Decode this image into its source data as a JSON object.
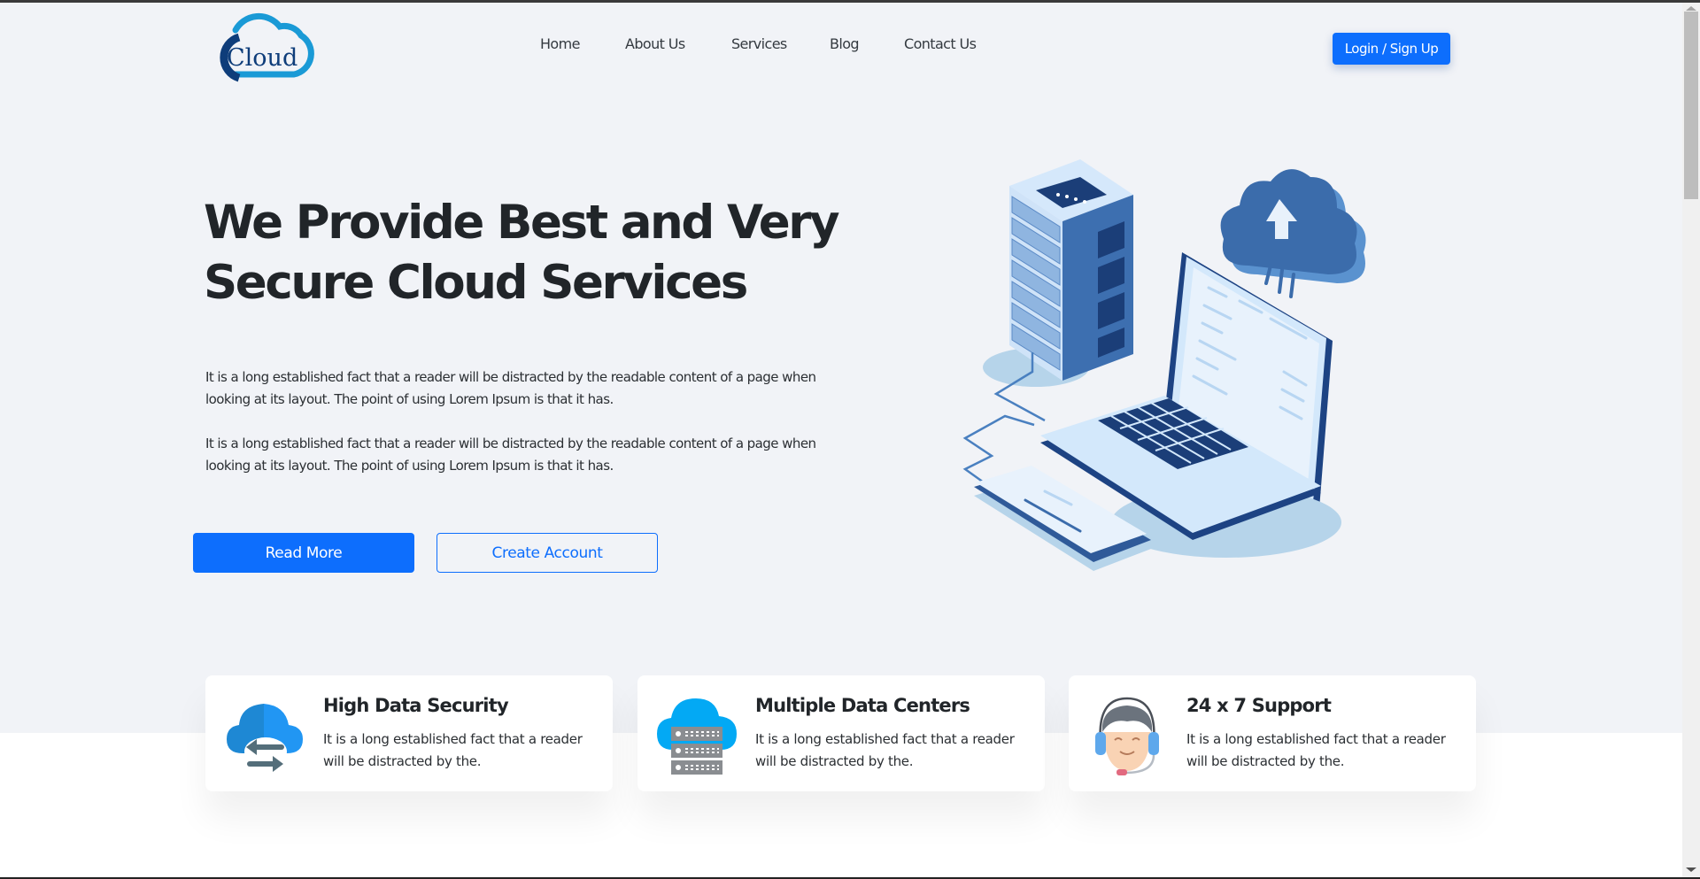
{
  "brand": {
    "logo_text": "Cloud",
    "primary_color": "#0d6efd",
    "logo_dark": "#0e3d7a",
    "logo_light": "#1a9ad6"
  },
  "nav": {
    "items": [
      {
        "label": "Home"
      },
      {
        "label": "About Us"
      },
      {
        "label": "Services"
      },
      {
        "label": "Blog"
      },
      {
        "label": "Contact Us"
      }
    ],
    "login_label": "Login / Sign Up"
  },
  "hero": {
    "title_line1": "We Provide Best and Very",
    "title_line2": "Secure Cloud Services",
    "paragraphs": [
      "It is a long established fact that a reader will be distracted by the readable content of a page when looking at its layout. The point of using Lorem Ipsum is that it has.",
      "It is a long established fact that a reader will be distracted by the readable content of a page when looking at its layout. The point of using Lorem Ipsum is that it has."
    ],
    "primary_button": "Read More",
    "secondary_button": "Create Account",
    "illustration": "cloud-server-laptop-illustration"
  },
  "features": [
    {
      "icon": "cloud-sync-icon",
      "title": "High Data Security",
      "text": "It is a long established fact that a reader will be distracted by the."
    },
    {
      "icon": "cloud-server-icon",
      "title": "Multiple Data Centers",
      "text": "It is a long established fact that a reader will be distracted by the."
    },
    {
      "icon": "support-agent-icon",
      "title": "24 x 7 Support",
      "text": "It is a long established fact that a reader will be distracted by the."
    }
  ]
}
